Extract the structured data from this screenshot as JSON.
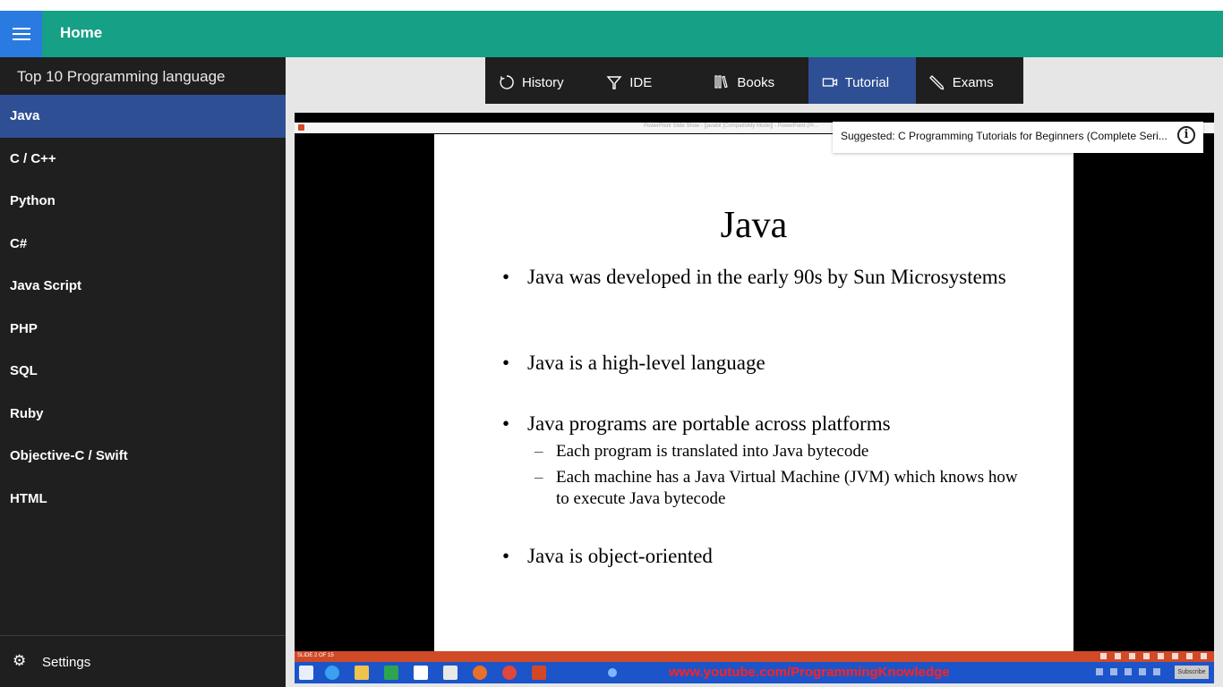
{
  "header": {
    "title": "Home",
    "menu_icon": "hamburger-menu-icon",
    "color": "#16a086"
  },
  "sidebar": {
    "title": "Top 10 Programming language",
    "items": [
      {
        "label": "Java",
        "active": true
      },
      {
        "label": "C / C++"
      },
      {
        "label": "Python"
      },
      {
        "label": "C#"
      },
      {
        "label": "Java Script"
      },
      {
        "label": "PHP"
      },
      {
        "label": "SQL"
      },
      {
        "label": "Ruby"
      },
      {
        "label": "Objective-C / Swift"
      },
      {
        "label": "HTML"
      }
    ],
    "settings_label": "Settings",
    "settings_icon": "gear-icon",
    "active_color": "#2e4f94"
  },
  "tabs": [
    {
      "label": "History",
      "icon": "history-icon"
    },
    {
      "label": "IDE",
      "icon": "ide-icon"
    },
    {
      "label": "Books",
      "icon": "books-icon"
    },
    {
      "label": "Tutorial",
      "icon": "video-camera-icon",
      "active": true
    },
    {
      "label": "Exams",
      "icon": "pencil-icon"
    }
  ],
  "video": {
    "suggestion": "Suggested: C Programming Tutorials for Beginners (Complete Seri...",
    "ppt_window_title": "PowerPoint Slide Show - [javabit [Compatibility Mode]] - PowerPoint (Pr...",
    "slide": {
      "title": "Java",
      "bullets": [
        {
          "text": "Java was developed in the early 90s by Sun Microsystems"
        },
        {
          "text": "Java is a high-level language"
        },
        {
          "text": "Java programs are portable across platforms",
          "subs": [
            "Each program is translated into Java bytecode",
            "Each machine has a Java Virtual Machine (JVM) which knows how to execute Java bytecode"
          ]
        },
        {
          "text": "Java is object-oriented"
        }
      ]
    },
    "slide_counter": "SLIDE 2 OF 15",
    "watermark_url": "www.youtube.com/ProgrammingKnowledge",
    "subscribe_label": "Subscribe"
  }
}
